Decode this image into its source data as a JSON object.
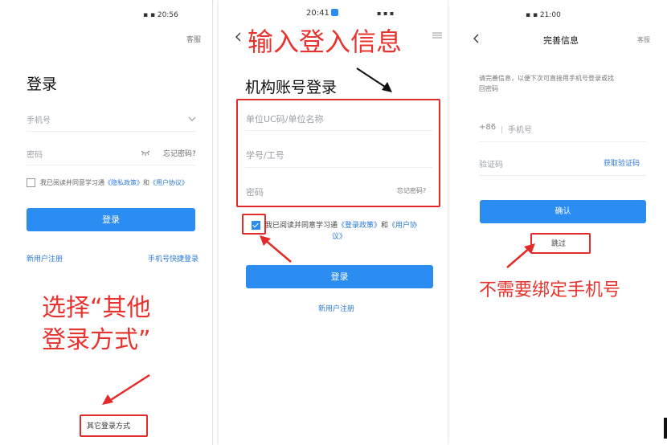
{
  "screen1": {
    "status": "▪ ▪ 20:56",
    "service": "客服",
    "title": "登录",
    "phone_placeholder": "手机号",
    "password_placeholder": "密码",
    "forgot": "忘记密码?",
    "agree_prefix": "我已阅读并同意学习通",
    "privacy": "《隐私政策》",
    "and": "和",
    "user_agreement": "《用户协议》",
    "login_button": "登录",
    "register": "新用户注册",
    "quick_login": "手机号快捷登录",
    "annotation_line1": "选择“其他",
    "annotation_line2": "登录方式”",
    "other_login": "其它登录方式"
  },
  "screen2": {
    "status_time": "20:41",
    "status_icons": "▪ ▪ ▪",
    "annotation": "输入登入信息",
    "title": "机构账号登录",
    "unit_placeholder": "单位UC码/单位名称",
    "id_placeholder": "学号/工号",
    "password_placeholder": "密码",
    "forgot": "忘记密码?",
    "agree_prefix": "我已阅读并同意学习通",
    "login_policy": "《登录政策》",
    "and": "和",
    "user_agreement_1": "《用户协",
    "user_agreement_2": "议》",
    "login_button": "登录",
    "register": "新用户注册"
  },
  "screen3": {
    "status": "▪ ▪ 21:00",
    "title": "完善信息",
    "service": "客服",
    "hint_line1": "请完善信息，以便下次可直接用手机号登录或找",
    "hint_line2": "回密码",
    "country_code": "+86",
    "phone_placeholder": "手机号",
    "code_placeholder": "验证码",
    "get_code": "获取验证码",
    "confirm_button": "确认",
    "skip": "跳过",
    "annotation": "不需要绑定手机号"
  },
  "colors": {
    "accent_blue": "#2b8cf2",
    "annotation_red": "#e8322e"
  },
  "icons": [
    "back-arrow-icon",
    "chevron-down-icon",
    "eye-closed-icon",
    "checkbox-icon",
    "menu-icon",
    "annotation-arrow-icon"
  ]
}
